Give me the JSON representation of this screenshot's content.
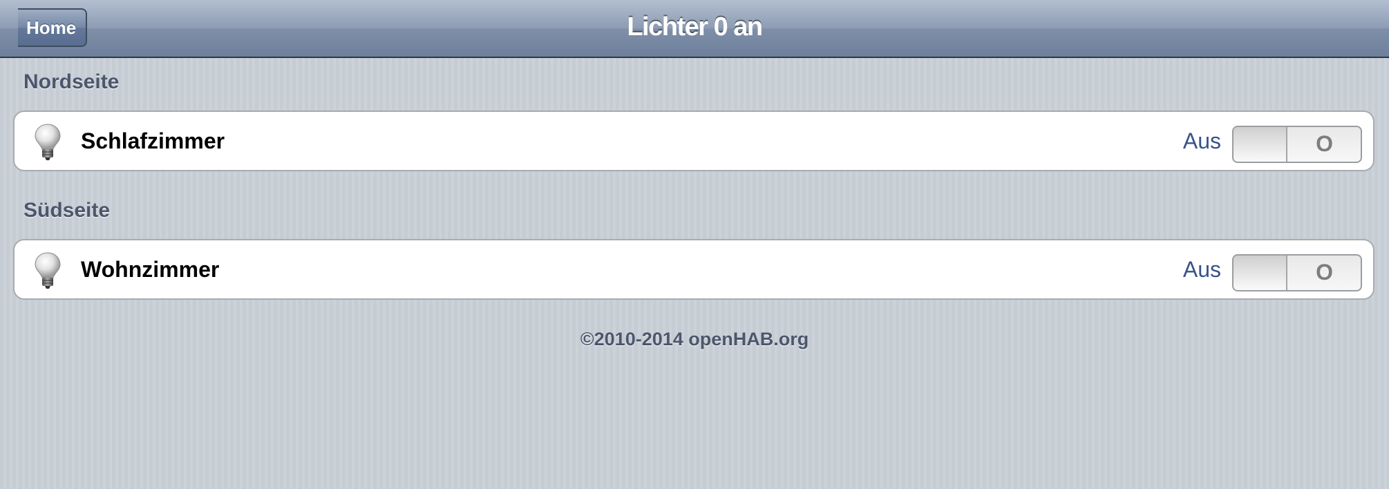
{
  "toolbar": {
    "title": "Lichter 0 an",
    "back_label": "Home"
  },
  "sections": [
    {
      "header": "Nordseite",
      "items": [
        {
          "label": "Schlafzimmer",
          "state": "Aus",
          "switch_text": "O",
          "icon": "lightbulb-icon",
          "on": false
        }
      ]
    },
    {
      "header": "Südseite",
      "items": [
        {
          "label": "Wohnzimmer",
          "state": "Aus",
          "switch_text": "O",
          "icon": "lightbulb-icon",
          "on": false
        }
      ]
    }
  ],
  "footer": "©2010-2014 openHAB.org",
  "colors": {
    "toolbar": "#6d7f9b",
    "background": "#c5ccd4",
    "state_text": "#385487",
    "section_header": "#4c566c"
  }
}
